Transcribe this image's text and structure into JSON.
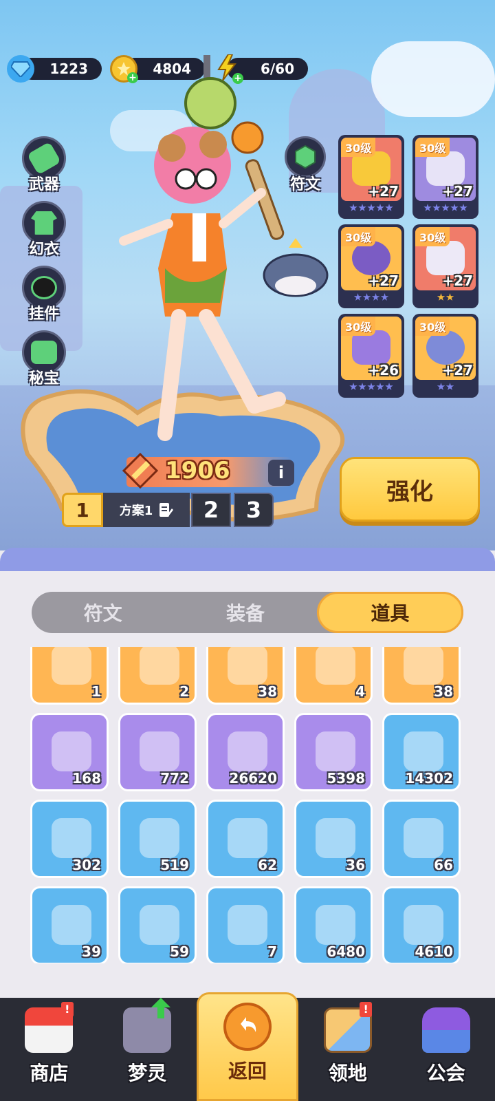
{
  "currencies": [
    {
      "name": "gem",
      "icon": "diamond-icon",
      "value": "1223",
      "color": "#3CA8F0"
    },
    {
      "name": "gold",
      "icon": "gold-coin-icon",
      "value": "4804",
      "color": "#F7C531"
    },
    {
      "name": "energy",
      "icon": "lightning-icon",
      "value": "6/60",
      "color": "#F5D11F"
    }
  ],
  "side_buttons": [
    {
      "label": "武器",
      "icon": "weapon-icon"
    },
    {
      "label": "幻衣",
      "icon": "outfit-icon"
    },
    {
      "label": "挂件",
      "icon": "pendant-icon"
    },
    {
      "label": "秘宝",
      "icon": "treasure-icon"
    }
  ],
  "rune_button": {
    "label": "符文",
    "icon": "rune-icon"
  },
  "equipment": [
    {
      "level": "30级",
      "bonus": "+27",
      "stars": 5,
      "star_color": "#7C83E8",
      "bg": "#F07C6A",
      "icon": "helmet-icon"
    },
    {
      "level": "30级",
      "bonus": "+27",
      "stars": 5,
      "star_color": "#7C83E8",
      "bg": "#9E8BE0",
      "icon": "jacket-icon"
    },
    {
      "level": "30级",
      "bonus": "+27",
      "stars": 4,
      "star_color": "#7C83E8",
      "bg": "#FFBE4F",
      "icon": "bracer-icon"
    },
    {
      "level": "30级",
      "bonus": "+27",
      "stars": 2,
      "star_color": "#F5B93A",
      "bg": "#F07C6A",
      "icon": "shorts-icon"
    },
    {
      "level": "30级",
      "bonus": "+26",
      "stars": 5,
      "star_color": "#7C83E8",
      "bg": "#FFBE4F",
      "icon": "shoe-icon"
    },
    {
      "level": "30级",
      "bonus": "+27",
      "stars": 2,
      "star_color": "#7C83E8",
      "bg": "#FFBE4F",
      "icon": "eye-gadget-icon"
    }
  ],
  "power": {
    "value": "1906",
    "info_label": "i"
  },
  "plans": [
    {
      "label": "1"
    },
    {
      "label": "方案1"
    },
    {
      "label": "2"
    },
    {
      "label": "3"
    }
  ],
  "enhance_label": "强化",
  "tabs": [
    {
      "label": "符文",
      "active": false
    },
    {
      "label": "装备",
      "active": false
    },
    {
      "label": "道具",
      "active": true
    }
  ],
  "items": [
    {
      "qty": "1",
      "bg": "#FFB653",
      "icon": "gift-machine-icon"
    },
    {
      "qty": "2",
      "bg": "#FFB653",
      "icon": "puzzle-icon"
    },
    {
      "qty": "38",
      "bg": "#FFB653",
      "icon": "gold-key-icon"
    },
    {
      "qty": "4",
      "bg": "#FFB653",
      "icon": "crystal-lantern-icon"
    },
    {
      "qty": "38",
      "bg": "#FFB653",
      "icon": "ticket-icon"
    },
    {
      "qty": "168",
      "bg": "#A98CEB",
      "icon": "purple-key-icon"
    },
    {
      "qty": "772",
      "bg": "#A98CEB",
      "icon": "spirit-urn-icon"
    },
    {
      "qty": "26620",
      "bg": "#A98CEB",
      "icon": "green-crystal-icon"
    },
    {
      "qty": "5398",
      "bg": "#A98CEB",
      "icon": "rainbow-bottle-icon"
    },
    {
      "qty": "14302",
      "bg": "#5FB8F0",
      "icon": "pink-medal-icon"
    },
    {
      "qty": "302",
      "bg": "#5FB8F0",
      "icon": "blue-dust-icon"
    },
    {
      "qty": "519",
      "bg": "#5FB8F0",
      "icon": "blue-rune-icon"
    },
    {
      "qty": "62",
      "bg": "#5FB8F0",
      "icon": "helmet-blueprint-icon"
    },
    {
      "qty": "36",
      "bg": "#5FB8F0",
      "icon": "jacket-blueprint-icon"
    },
    {
      "qty": "66",
      "bg": "#5FB8F0",
      "icon": "bracer-blueprint-icon"
    },
    {
      "qty": "39",
      "bg": "#5FB8F0",
      "icon": "shorts-blueprint-icon"
    },
    {
      "qty": "59",
      "bg": "#5FB8F0",
      "icon": "shoe-blueprint-icon"
    },
    {
      "qty": "7",
      "bg": "#5FB8F0",
      "icon": "glove-blueprint-icon"
    },
    {
      "qty": "6480",
      "bg": "#5FB8F0",
      "icon": "orange-drink-icon"
    },
    {
      "qty": "4610",
      "bg": "#5FB8F0",
      "icon": "purple-drink-icon"
    }
  ],
  "nav": [
    {
      "label": "商店",
      "icon": "shop-icon",
      "badge": "!",
      "active": false
    },
    {
      "label": "梦灵",
      "icon": "robot-icon",
      "badge": "up-arrow",
      "active": false
    },
    {
      "label": "返回",
      "icon": "back-arrow-icon",
      "badge": "",
      "active": true
    },
    {
      "label": "领地",
      "icon": "territory-icon",
      "badge": "!",
      "active": false
    },
    {
      "label": "公会",
      "icon": "guild-icon",
      "badge": "",
      "active": false
    }
  ]
}
